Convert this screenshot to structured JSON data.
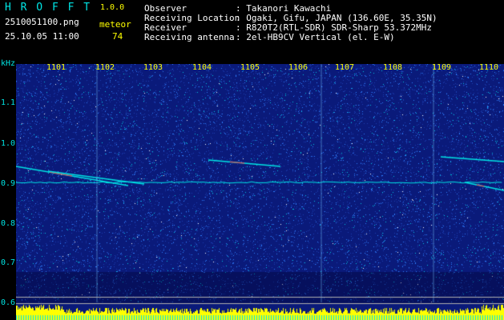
{
  "header": {
    "app_title": "H R O F F T",
    "version": "1.0.0",
    "filename": "2510051100.png",
    "meteor_label": "meteor",
    "datetime": "25.10.05 11:00",
    "meteor_count": "74"
  },
  "info": [
    {
      "label": "Observer",
      "value": ": Takanori Kawachi"
    },
    {
      "label": "Receiving Location",
      "value": ": Ogaki, Gifu, JAPAN (136.60E, 35.35N)"
    },
    {
      "label": "Receiver",
      "value": ": R820T2(RTL-SDR) SDR-Sharp 53.372MHz"
    },
    {
      "label": "Receiving antenna",
      "value": ": 2el-HB9CV Vertical (el. E-W)"
    }
  ],
  "axis": {
    "y_unit": "kHz",
    "y_ticks": [
      "1.1",
      "1.0",
      "0.9",
      "0.8",
      "0.7",
      "0.6"
    ],
    "x_ticks": [
      "1101",
      "1102",
      "1103",
      "1104",
      "1105",
      "1106",
      "1107",
      "1108",
      "1109",
      "1110"
    ]
  },
  "colors": {
    "background": "#000000",
    "spectrogram_base": "#0a1a7a",
    "noise_bright": "#2f7fff",
    "signal": "#00e5e5",
    "meteor_hot": "#ff4040",
    "label_cyan": "#00e5e5",
    "label_yellow": "#ffff00"
  }
}
